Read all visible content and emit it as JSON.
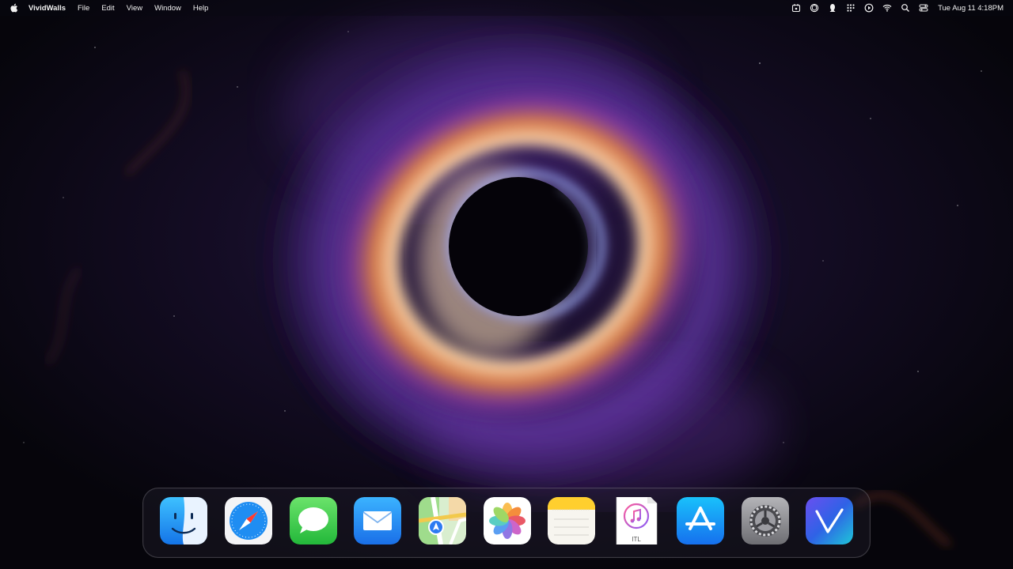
{
  "menubar": {
    "apple_icon": "apple-logo-icon",
    "app_name": "VividWalls",
    "menus": [
      "File",
      "Edit",
      "View",
      "Window",
      "Help"
    ],
    "status_icons": [
      "calendar-badge-icon",
      "chatgpt-icon",
      "alien-icon",
      "grid-dots-icon",
      "play-circle-icon",
      "wifi-icon",
      "search-icon",
      "control-center-icon"
    ],
    "clock": "Tue Aug 11  4:18PM"
  },
  "dock": {
    "apps": [
      {
        "name": "Finder",
        "icon": "finder-icon"
      },
      {
        "name": "Safari",
        "icon": "safari-icon"
      },
      {
        "name": "Messages",
        "icon": "messages-icon"
      },
      {
        "name": "Mail",
        "icon": "mail-icon"
      },
      {
        "name": "Maps",
        "icon": "maps-icon"
      },
      {
        "name": "Photos",
        "icon": "photos-icon"
      },
      {
        "name": "Notes",
        "icon": "notes-icon"
      },
      {
        "name": "ITL",
        "icon": "itl-file-icon",
        "label": "ITL"
      },
      {
        "name": "App Store",
        "icon": "app-store-icon"
      },
      {
        "name": "System Settings",
        "icon": "system-settings-icon"
      },
      {
        "name": "VividWalls",
        "icon": "vividwalls-icon"
      }
    ]
  },
  "colors": {
    "wallpaper_base": "#07060d",
    "nebula_purple": "#5b2f9a",
    "nebula_orange": "#f08a4a",
    "core_glow": "#ffd7a8"
  }
}
